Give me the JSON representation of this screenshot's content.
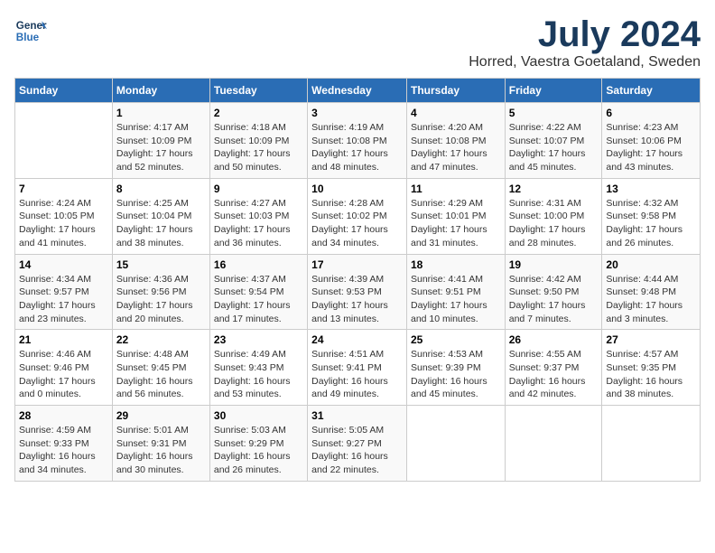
{
  "header": {
    "logo_line1": "General",
    "logo_line2": "Blue",
    "month": "July 2024",
    "location": "Horred, Vaestra Goetaland, Sweden"
  },
  "days_of_week": [
    "Sunday",
    "Monday",
    "Tuesday",
    "Wednesday",
    "Thursday",
    "Friday",
    "Saturday"
  ],
  "weeks": [
    [
      {
        "day": "",
        "info": ""
      },
      {
        "day": "1",
        "info": "Sunrise: 4:17 AM\nSunset: 10:09 PM\nDaylight: 17 hours\nand 52 minutes."
      },
      {
        "day": "2",
        "info": "Sunrise: 4:18 AM\nSunset: 10:09 PM\nDaylight: 17 hours\nand 50 minutes."
      },
      {
        "day": "3",
        "info": "Sunrise: 4:19 AM\nSunset: 10:08 PM\nDaylight: 17 hours\nand 48 minutes."
      },
      {
        "day": "4",
        "info": "Sunrise: 4:20 AM\nSunset: 10:08 PM\nDaylight: 17 hours\nand 47 minutes."
      },
      {
        "day": "5",
        "info": "Sunrise: 4:22 AM\nSunset: 10:07 PM\nDaylight: 17 hours\nand 45 minutes."
      },
      {
        "day": "6",
        "info": "Sunrise: 4:23 AM\nSunset: 10:06 PM\nDaylight: 17 hours\nand 43 minutes."
      }
    ],
    [
      {
        "day": "7",
        "info": "Sunrise: 4:24 AM\nSunset: 10:05 PM\nDaylight: 17 hours\nand 41 minutes."
      },
      {
        "day": "8",
        "info": "Sunrise: 4:25 AM\nSunset: 10:04 PM\nDaylight: 17 hours\nand 38 minutes."
      },
      {
        "day": "9",
        "info": "Sunrise: 4:27 AM\nSunset: 10:03 PM\nDaylight: 17 hours\nand 36 minutes."
      },
      {
        "day": "10",
        "info": "Sunrise: 4:28 AM\nSunset: 10:02 PM\nDaylight: 17 hours\nand 34 minutes."
      },
      {
        "day": "11",
        "info": "Sunrise: 4:29 AM\nSunset: 10:01 PM\nDaylight: 17 hours\nand 31 minutes."
      },
      {
        "day": "12",
        "info": "Sunrise: 4:31 AM\nSunset: 10:00 PM\nDaylight: 17 hours\nand 28 minutes."
      },
      {
        "day": "13",
        "info": "Sunrise: 4:32 AM\nSunset: 9:58 PM\nDaylight: 17 hours\nand 26 minutes."
      }
    ],
    [
      {
        "day": "14",
        "info": "Sunrise: 4:34 AM\nSunset: 9:57 PM\nDaylight: 17 hours\nand 23 minutes."
      },
      {
        "day": "15",
        "info": "Sunrise: 4:36 AM\nSunset: 9:56 PM\nDaylight: 17 hours\nand 20 minutes."
      },
      {
        "day": "16",
        "info": "Sunrise: 4:37 AM\nSunset: 9:54 PM\nDaylight: 17 hours\nand 17 minutes."
      },
      {
        "day": "17",
        "info": "Sunrise: 4:39 AM\nSunset: 9:53 PM\nDaylight: 17 hours\nand 13 minutes."
      },
      {
        "day": "18",
        "info": "Sunrise: 4:41 AM\nSunset: 9:51 PM\nDaylight: 17 hours\nand 10 minutes."
      },
      {
        "day": "19",
        "info": "Sunrise: 4:42 AM\nSunset: 9:50 PM\nDaylight: 17 hours\nand 7 minutes."
      },
      {
        "day": "20",
        "info": "Sunrise: 4:44 AM\nSunset: 9:48 PM\nDaylight: 17 hours\nand 3 minutes."
      }
    ],
    [
      {
        "day": "21",
        "info": "Sunrise: 4:46 AM\nSunset: 9:46 PM\nDaylight: 17 hours\nand 0 minutes."
      },
      {
        "day": "22",
        "info": "Sunrise: 4:48 AM\nSunset: 9:45 PM\nDaylight: 16 hours\nand 56 minutes."
      },
      {
        "day": "23",
        "info": "Sunrise: 4:49 AM\nSunset: 9:43 PM\nDaylight: 16 hours\nand 53 minutes."
      },
      {
        "day": "24",
        "info": "Sunrise: 4:51 AM\nSunset: 9:41 PM\nDaylight: 16 hours\nand 49 minutes."
      },
      {
        "day": "25",
        "info": "Sunrise: 4:53 AM\nSunset: 9:39 PM\nDaylight: 16 hours\nand 45 minutes."
      },
      {
        "day": "26",
        "info": "Sunrise: 4:55 AM\nSunset: 9:37 PM\nDaylight: 16 hours\nand 42 minutes."
      },
      {
        "day": "27",
        "info": "Sunrise: 4:57 AM\nSunset: 9:35 PM\nDaylight: 16 hours\nand 38 minutes."
      }
    ],
    [
      {
        "day": "28",
        "info": "Sunrise: 4:59 AM\nSunset: 9:33 PM\nDaylight: 16 hours\nand 34 minutes."
      },
      {
        "day": "29",
        "info": "Sunrise: 5:01 AM\nSunset: 9:31 PM\nDaylight: 16 hours\nand 30 minutes."
      },
      {
        "day": "30",
        "info": "Sunrise: 5:03 AM\nSunset: 9:29 PM\nDaylight: 16 hours\nand 26 minutes."
      },
      {
        "day": "31",
        "info": "Sunrise: 5:05 AM\nSunset: 9:27 PM\nDaylight: 16 hours\nand 22 minutes."
      },
      {
        "day": "",
        "info": ""
      },
      {
        "day": "",
        "info": ""
      },
      {
        "day": "",
        "info": ""
      }
    ]
  ]
}
